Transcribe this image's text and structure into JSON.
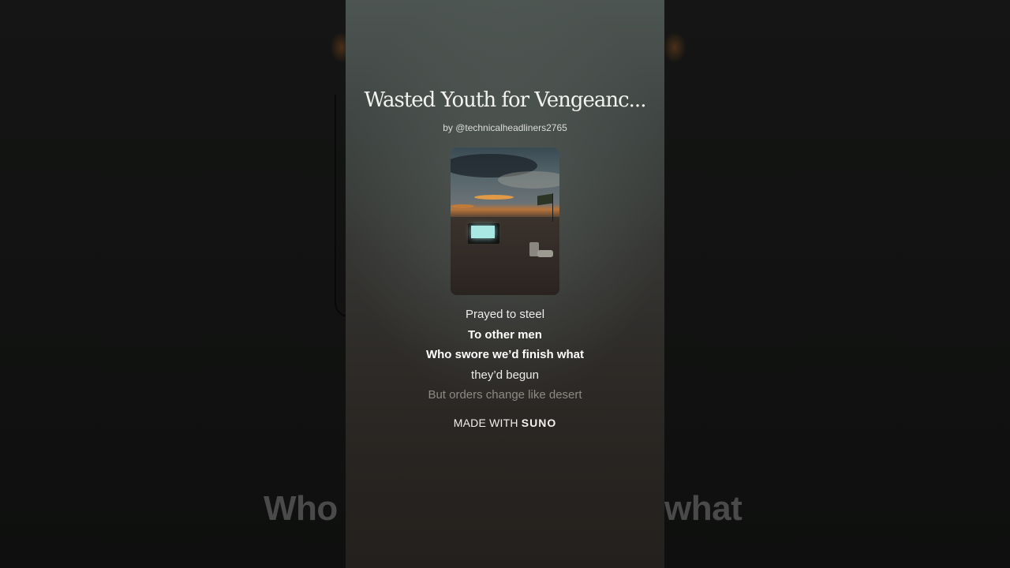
{
  "song": {
    "title": "Wasted Youth for Vengeanc...",
    "artist_byline": "by @technicalheadliners2765"
  },
  "lyrics": {
    "lines": [
      "Prayed to steel",
      "To other men",
      "Who swore we’d finish what",
      "they’d begun",
      "But orders change like desert"
    ]
  },
  "footer": {
    "made_with_prefix": "MADE WITH",
    "brand": "SUNO"
  },
  "background_caption": {
    "left_fragment": "Who",
    "right_fragment": "what"
  },
  "colors": {
    "panel_top": "#4d5552",
    "panel_bottom": "#24201d",
    "text_primary": "#ffffff",
    "text_faded": "#8d8a86"
  }
}
